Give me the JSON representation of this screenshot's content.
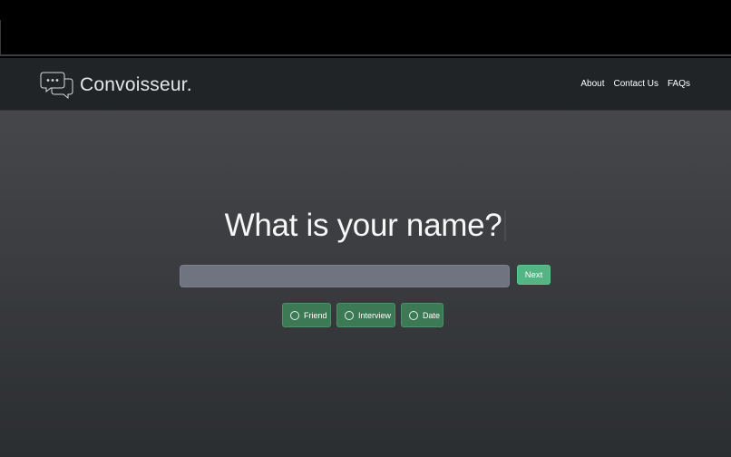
{
  "brand": {
    "name": "Convoisseur.",
    "logo_icon": "chat-bubbles-icon"
  },
  "nav": {
    "links": [
      {
        "label": "About"
      },
      {
        "label": "Contact Us"
      },
      {
        "label": "FAQs"
      }
    ]
  },
  "main": {
    "question": "What is your name?",
    "name_input": {
      "value": "",
      "placeholder": ""
    },
    "next_label": "Next",
    "options": [
      {
        "label": "Friend",
        "icon": "radio-circle-icon"
      },
      {
        "label": "Interview",
        "icon": "radio-circle-icon"
      },
      {
        "label": "Date",
        "icon": "radio-circle-icon"
      }
    ]
  },
  "colors": {
    "navbar_bg": "#212427",
    "accent_green": "#52b583",
    "option_green": "#3c7a56",
    "input_bg": "#6f7480"
  }
}
